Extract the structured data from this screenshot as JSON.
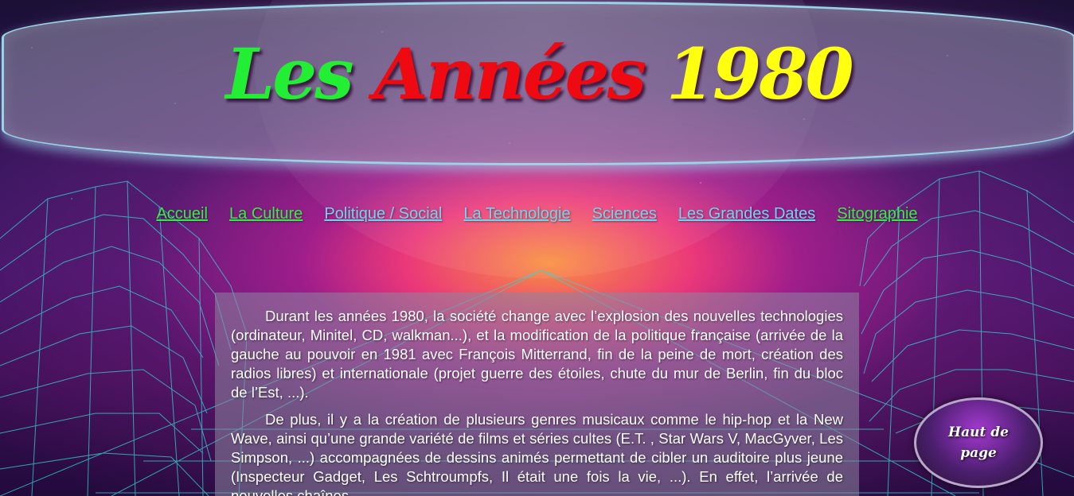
{
  "header": {
    "title_part1": "Les",
    "title_part2": "Années",
    "title_part3": "1980",
    "colors": {
      "part1": "#22ee33",
      "part2": "#ee0a10",
      "part3": "#ffff10"
    }
  },
  "nav": {
    "items": [
      {
        "label": "Accueil",
        "color": "#33ee44"
      },
      {
        "label": "La Culture",
        "color": "#33ee44"
      },
      {
        "label": "Politique / Social",
        "color": "#6fd6f0"
      },
      {
        "label": "La Technologie",
        "color": "#6fd6f0"
      },
      {
        "label": "Sciences",
        "color": "#6fd6f0"
      },
      {
        "label": "Les Grandes Dates",
        "color": "#6fd6f0"
      },
      {
        "label": "Sitographie",
        "color": "#33ee44"
      }
    ]
  },
  "content": {
    "paragraphs": [
      "Durant les années 1980, la société change avec l’explosion des nouvelles technologies (ordinateur, Minitel, CD, walkman...), et la modification de la politique française (arrivée de la gauche au pouvoir en 1981 avec François Mitterrand, fin de la peine de mort, création des radios libres) et internationale (projet guerre des étoiles, chute du mur de Berlin, fin du bloc de l’Est, ...).",
      "De plus, il y a la création de plusieurs genres musicaux comme le hip-hop et la New Wave, ainsi qu’une grande variété de films et séries cultes (E.T. , Star Wars V, MacGyver, Les Simpson, ...) accompagnées de dessins animés permettant de cibler un auditoire plus jeune (Inspecteur Gadget, Les Schtroumpfs, Il était une fois la vie, ...). En effet, l’arrivée de nouvelles chaînes"
    ]
  },
  "back_to_top": {
    "label": "Haut de page"
  }
}
